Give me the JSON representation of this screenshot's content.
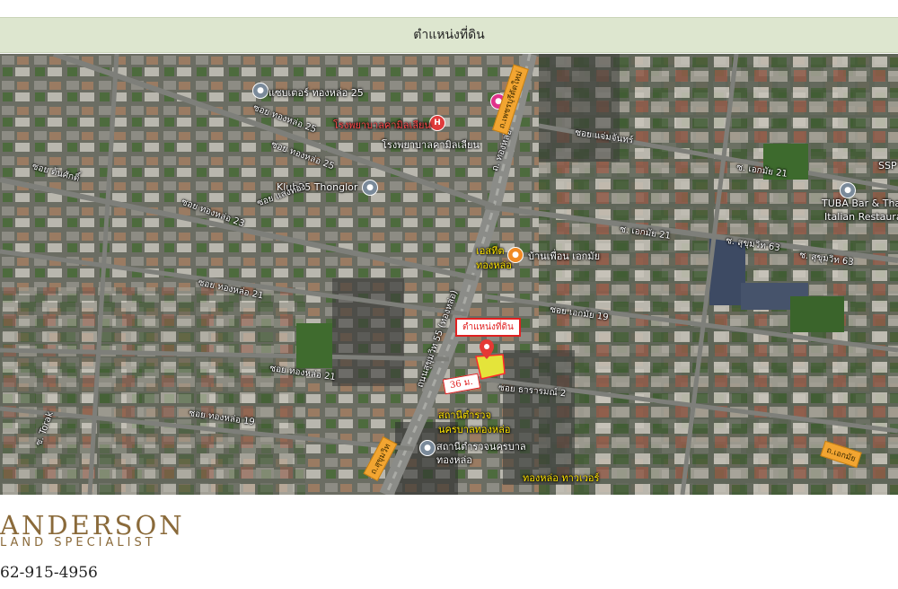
{
  "header": {
    "title": "ตำแหน่งที่ดิน"
  },
  "map": {
    "labels": {
      "cafe_25": "แซบเตอร์ ทองหล่อ 25",
      "hospital_red": "โรงพยาบาลคามิลเลียน",
      "hospital_white": "โรงพยาบาลคามิลเลียน",
      "klub25": "Klub25 Thonglor",
      "tuba_1": "TUBA Bar & Tha",
      "tuba_2": "Italian Restauran",
      "ssp": "SSP",
      "soi_chaem_chan": "ซอย แจ่มจันทร์",
      "soi_ekkamai_21": "ซ. เอกมัย 21",
      "soi_ekkamai_21b": "ซ. เอกมัย 21",
      "sukhumvit_63a": "ซ. สุขุมวิท 63",
      "sukhumvit_63b": "ซ. สุขุมวิท 63",
      "soi_ekkamai_19": "ซอย เอกมัย 19",
      "soi_thonglo_25": "ซอย ทองหล่อ 25",
      "soi_thonglo_25b": "ซอย ทองหล่อ 25",
      "soi_thonglo_23": "ซอย ทองหล่อ 23",
      "soi_thonglo_21": "ซอย ทองหล่อ 21",
      "soi_thonglo_21b": "ซอย ทองหล่อ 21",
      "soi_thonglo_19": "ซอย ทองหล่อ 19",
      "soi_tonsak": "ซอย ต้นศักดิ์",
      "soi_sangthong": "ซอย แสงทอง",
      "soi_thararom": "ซอย ธารารมณ์ 2",
      "thonglo_road": "ถ. ทองหล่อ",
      "sukhumvit55": "ถนนสุขุมวิท 55 (ทองหล่อ)",
      "elgit_1": "เอสทีต",
      "elgit_2": "ทองหล่อ",
      "banpuen": "บ้านเพื่อน เอกมัย",
      "police_1": "สถานีตำรวจ",
      "police_2": "นครบาลทองหล่อ",
      "police_3": "สถานีตำรวจนครบาล",
      "police_4": "ทองหล่อ",
      "thonglo_tower": "ทองหล่อ ทาวเวอร์",
      "soi_torak": "ซ. Torak"
    },
    "signs": {
      "phetchaburi": "ถ.เพชรบุรีตัดใหม่",
      "sukhumvit": "ถ.สุขุมวิท",
      "ekkamai": "ถ.เอกมัย"
    },
    "callout": "ตำแหน่งที่ดิน",
    "distance": "36 ม."
  },
  "footer": {
    "logo_main": "ANDERSON",
    "logo_sub": "LAND SPECIALIST",
    "phone": "62-915-4956"
  }
}
